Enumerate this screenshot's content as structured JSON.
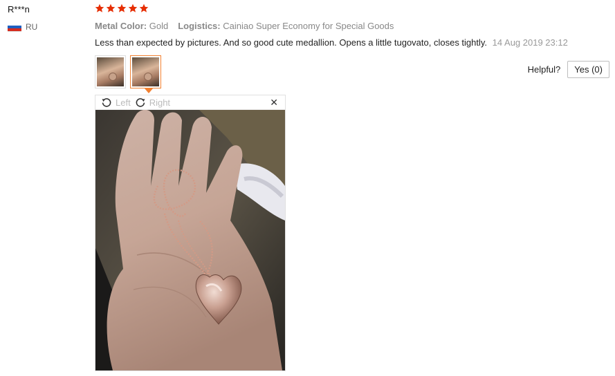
{
  "reviewer": {
    "name": "R***n",
    "country": "RU",
    "flag_colors": [
      "#ffffff",
      "#1f5fbf",
      "#d52b1e"
    ]
  },
  "rating": {
    "stars": 5,
    "max": 5,
    "star_color": "#e62e04"
  },
  "attributes": [
    {
      "key": "Metal Color:",
      "value": "Gold"
    },
    {
      "key": "Logistics:",
      "value": "Cainiao Super Economy for Special Goods"
    }
  ],
  "review": {
    "text": "Less than expected by pictures. And so good cute medallion. Opens a little tugovato, closes tightly.",
    "date": "14 Aug 2019 23:12"
  },
  "thumbnails": [
    {
      "name": "review-photo-1",
      "active": false
    },
    {
      "name": "review-photo-2",
      "active": true
    }
  ],
  "helpful": {
    "label": "Helpful?",
    "yes_label": "Yes (0)"
  },
  "viewer": {
    "rotate_left_label": "Left",
    "rotate_right_label": "Right",
    "rotate_left_icon": "rotate-left-icon",
    "rotate_right_icon": "rotate-right-icon",
    "close_icon": "close-icon",
    "close_glyph": "✕"
  }
}
